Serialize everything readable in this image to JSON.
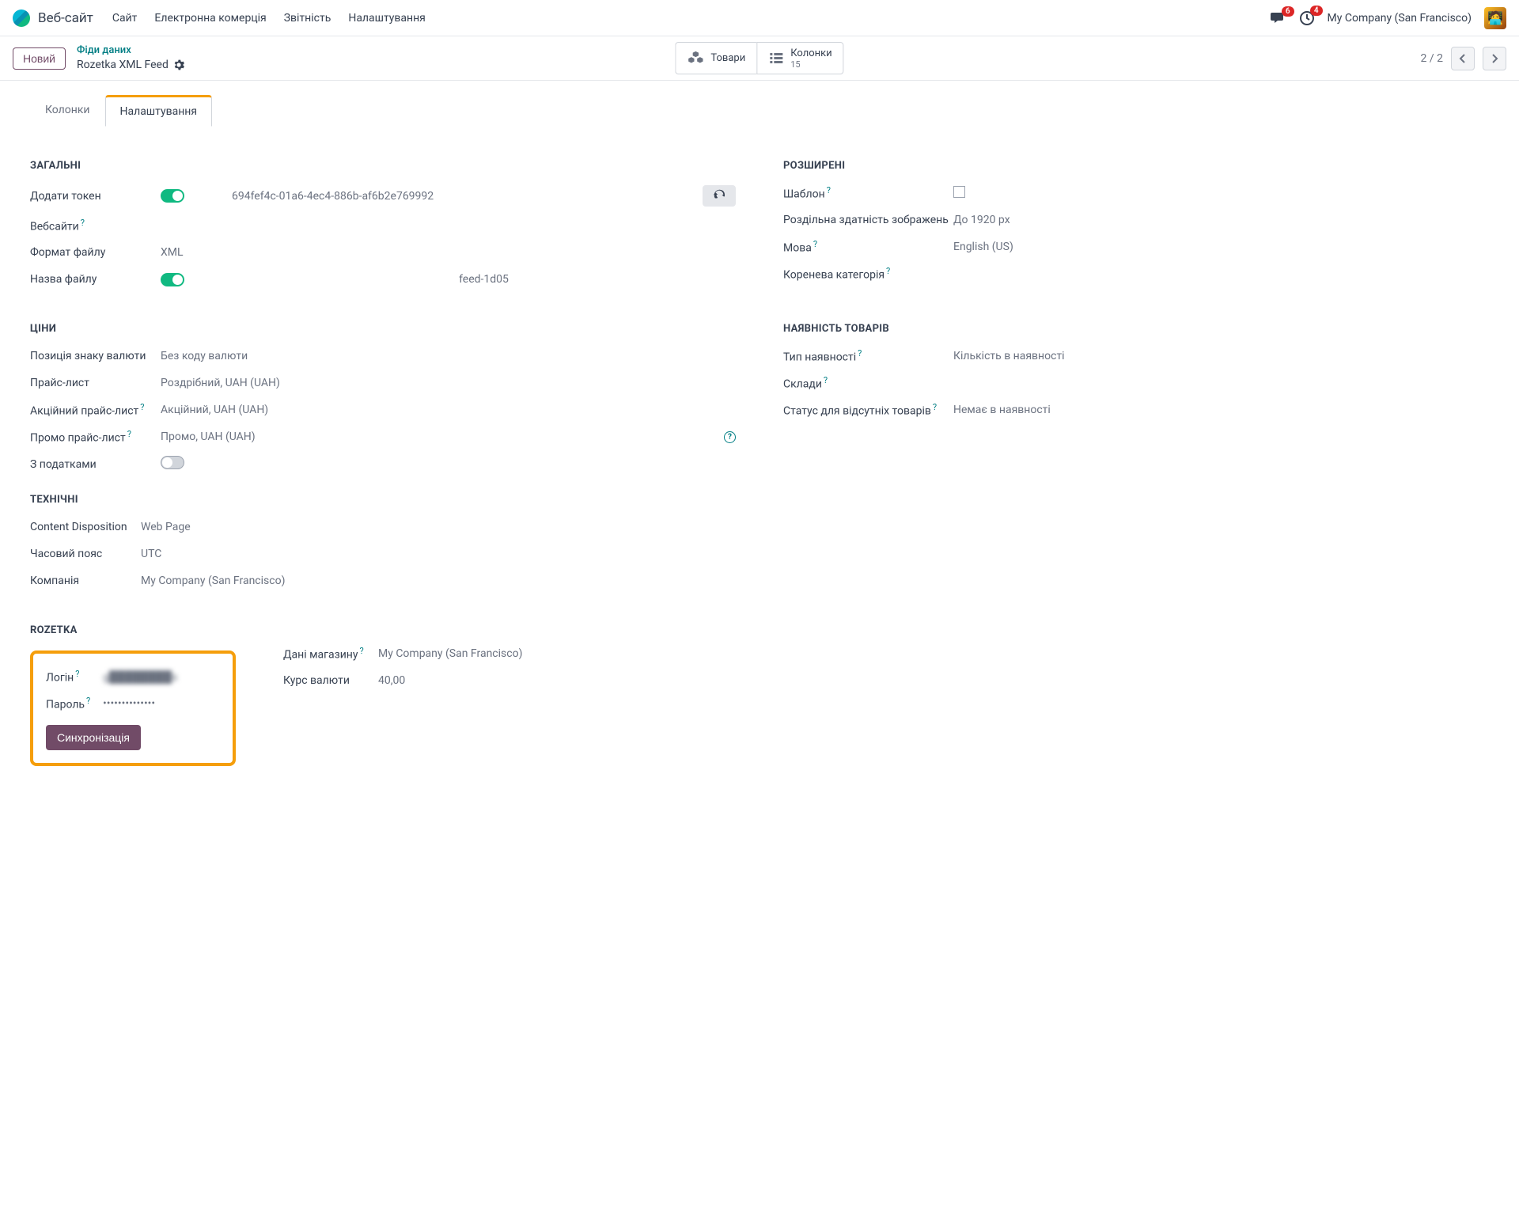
{
  "nav": {
    "app": "Веб-сайт",
    "links": [
      "Сайт",
      "Електронна комерція",
      "Звітність",
      "Налаштування"
    ],
    "chat_badge": "6",
    "activity_badge": "4",
    "company": "My Company (San Francisco)"
  },
  "control": {
    "new_btn": "Новий",
    "breadcrumb_parent": "Фіди даних",
    "breadcrumb_current": "Rozetka XML Feed",
    "btn_products": "Товари",
    "btn_columns": "Колонки",
    "btn_columns_count": "15",
    "page": "2 / 2"
  },
  "tabs": {
    "columns": "Колонки",
    "settings": "Налаштування"
  },
  "sections": {
    "general": "ЗАГАЛЬНІ",
    "advanced": "РОЗШИРЕНІ",
    "prices": "ЦІНИ",
    "stock": "НАЯВНІСТЬ ТОВАРІВ",
    "technical": "ТЕХНІЧНІ",
    "rozetka": "ROZETKA"
  },
  "general": {
    "add_token_label": "Додати токен",
    "token_value": "694fef4c-01a6-4ec4-886b-af6b2e769992",
    "websites_label": "Вебсайти",
    "file_format_label": "Формат файлу",
    "file_format_value": "XML",
    "file_name_label": "Назва файлу",
    "file_name_value": "feed-1d05"
  },
  "advanced": {
    "template_label": "Шаблон",
    "img_res_label": "Роздільна здатність зображень",
    "img_res_value": "До 1920 px",
    "lang_label": "Мова",
    "lang_value": "English (US)",
    "root_cat_label": "Коренева категорія"
  },
  "prices": {
    "curr_pos_label": "Позиція знаку валюти",
    "curr_pos_value": "Без коду валюти",
    "pricelist_label": "Прайс-лист",
    "pricelist_value": "Роздрібний, UAH (UAH)",
    "sale_pl_label": "Акційний прайс-лист",
    "sale_pl_value": "Акційний, UAH (UAH)",
    "promo_pl_label": "Промо прайс-лист",
    "promo_pl_value": "Промо, UAH (UAH)",
    "tax_label": "З податками"
  },
  "stock": {
    "avail_type_label": "Тип наявності",
    "avail_type_value": "Кількість в наявності",
    "warehouses_label": "Склади",
    "oos_label": "Статус для відсутніх товарів",
    "oos_value": "Немає в наявності"
  },
  "technical": {
    "cd_label": "Content Disposition",
    "cd_value": "Web Page",
    "tz_label": "Часовий пояс",
    "tz_value": "UTC",
    "company_label": "Компанія",
    "company_value": "My Company (San Francisco)"
  },
  "rozetka": {
    "login_label": "Логін",
    "login_value": "g████████s",
    "pwd_label": "Пароль",
    "pwd_value": "••••••••••••••",
    "sync_btn": "Синхронізація",
    "store_label": "Дані магазину",
    "store_value": "My Company (San Francisco)",
    "rate_label": "Курс валюти",
    "rate_value": "40,00"
  }
}
